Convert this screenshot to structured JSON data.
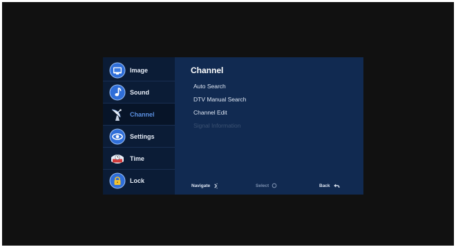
{
  "sidebar": {
    "items": [
      {
        "label": "Image",
        "icon": "image-icon",
        "active": false
      },
      {
        "label": "Sound",
        "icon": "sound-icon",
        "active": false
      },
      {
        "label": "Channel",
        "icon": "satellite-dish-icon",
        "active": true
      },
      {
        "label": "Settings",
        "icon": "settings-icon",
        "active": false
      },
      {
        "label": "Time",
        "icon": "clock-icon",
        "active": false
      },
      {
        "label": "Lock",
        "icon": "lock-icon",
        "active": false
      }
    ]
  },
  "content": {
    "title": "Channel",
    "items": [
      {
        "label": "Auto Search",
        "enabled": true
      },
      {
        "label": "DTV Manual Search",
        "enabled": true
      },
      {
        "label": "Channel Edit",
        "enabled": true
      },
      {
        "label": "Signal Information",
        "enabled": false
      }
    ]
  },
  "footer": {
    "navigate_label": "Navigate",
    "select_label": "Select",
    "back_label": "Back"
  },
  "colors": {
    "panel_background": "#112a51",
    "sidebar_background": "#0b1c36",
    "active_item_text": "#5a8fe0",
    "disabled_item_text": "#3c5273"
  }
}
